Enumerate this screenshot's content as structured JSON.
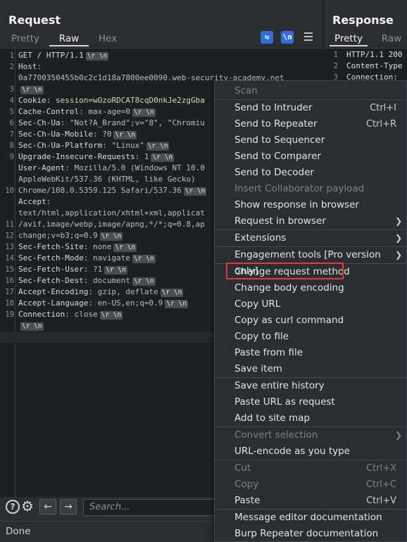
{
  "request": {
    "title": "Request",
    "tabs": [
      "Pretty",
      "Raw",
      "Hex"
    ],
    "active_tab": "Raw",
    "tool_icons": [
      "wrap-lines-icon",
      "newline-icon",
      "menu-icon"
    ],
    "line_numbers": [
      "1",
      "2",
      "",
      "3",
      "4",
      "5",
      "6",
      "7",
      "8",
      "9",
      "",
      "",
      "10",
      "",
      "",
      "11",
      "12",
      "13",
      "14",
      "15",
      "16",
      "17",
      "18",
      "19"
    ],
    "lines": [
      {
        "k": "GET / HTTP/1.1",
        "v": "",
        "crlf": true
      },
      {
        "k": "Host",
        "v": ":",
        "crlf": false
      },
      {
        "k": "",
        "v": "0a7700350455b0c2c1d18a7800ee0090.web-security-academy.net",
        "crlf": false
      },
      {
        "k": "",
        "v": "",
        "crlf": true
      },
      {
        "k": "Cookie",
        "v": ": session=wOzoRDCAT8cqD0nkJe2zgGba",
        "crlf": false
      },
      {
        "k": "Cache-Control",
        "v": ": max-age=0",
        "crlf": true
      },
      {
        "k": "Sec-Ch-Ua",
        "v": ": \"Not?A_Brand\";v=\"8\", \"Chromiu",
        "crlf": false
      },
      {
        "k": "Sec-Ch-Ua-Mobile",
        "v": ": ?0",
        "crlf": true
      },
      {
        "k": "Sec-Ch-Ua-Platform",
        "v": ": \"Linux\"",
        "crlf": true
      },
      {
        "k": "Upgrade-Insecure-Requests",
        "v": ": 1",
        "crlf": true
      },
      {
        "k": "User-Agent",
        "v": ": Mozilla/5.0 (Windows NT 10.0",
        "crlf": false
      },
      {
        "k": "",
        "v": "AppleWebKit/537.36 (KHTML, like Gecko)",
        "crlf": false
      },
      {
        "k": "",
        "v": "Chrome/108.0.5359.125 Safari/537.36",
        "crlf": true
      },
      {
        "k": "Accept",
        "v": ":",
        "crlf": false
      },
      {
        "k": "",
        "v": "text/html,application/xhtml+xml,applicat",
        "crlf": false
      },
      {
        "k": "",
        "v": "/avif,image/webp,image/apng,*/*;q=0.8,ap",
        "crlf": false
      },
      {
        "k": "",
        "v": "change;v=b3;q=0.9",
        "crlf": true
      },
      {
        "k": "Sec-Fetch-Site",
        "v": ": none",
        "crlf": true
      },
      {
        "k": "Sec-Fetch-Mode",
        "v": ": navigate",
        "crlf": true
      },
      {
        "k": "Sec-Fetch-User",
        "v": ": ?1",
        "crlf": true
      },
      {
        "k": "Sec-Fetch-Dest",
        "v": ": document",
        "crlf": true
      },
      {
        "k": "Accept-Encoding",
        "v": ": gzip, deflate",
        "crlf": true
      },
      {
        "k": "Accept-Language",
        "v": ": en-US,en;q=0.9",
        "crlf": true
      },
      {
        "k": "Connection",
        "v": ": close",
        "crlf": true
      },
      {
        "k": "",
        "v": "",
        "crlf": true
      },
      {
        "k": "",
        "v": "",
        "crlf": false
      }
    ],
    "crlf_label": "\\r \\n",
    "search_placeholder": "Search..."
  },
  "response": {
    "title": "Response",
    "tabs": [
      "Pretty",
      "Raw"
    ],
    "active_tab": "Pretty",
    "lines": [
      {
        "n": "1",
        "t": "HTTP/1.1 200"
      },
      {
        "n": "2",
        "t": "Content-Type"
      },
      {
        "n": "3",
        "t": "Connection:"
      }
    ]
  },
  "status": "Done",
  "context_menu": {
    "items": [
      {
        "label": "Scan",
        "shortcut": "",
        "disabled": true,
        "submenu": false
      },
      {
        "sep": true
      },
      {
        "label": "Send to Intruder",
        "shortcut": "Ctrl+I",
        "disabled": false,
        "submenu": false
      },
      {
        "label": "Send to Repeater",
        "shortcut": "Ctrl+R",
        "disabled": false,
        "submenu": false
      },
      {
        "label": "Send to Sequencer",
        "shortcut": "",
        "disabled": false,
        "submenu": false
      },
      {
        "label": "Send to Comparer",
        "shortcut": "",
        "disabled": false,
        "submenu": false
      },
      {
        "label": "Send to Decoder",
        "shortcut": "",
        "disabled": false,
        "submenu": false
      },
      {
        "label": "Insert Collaborator payload",
        "shortcut": "",
        "disabled": true,
        "submenu": false
      },
      {
        "label": "Show response in browser",
        "shortcut": "",
        "disabled": false,
        "submenu": false
      },
      {
        "label": "Request in browser",
        "shortcut": "",
        "disabled": false,
        "submenu": true
      },
      {
        "sep": true
      },
      {
        "label": "Extensions",
        "shortcut": "",
        "disabled": false,
        "submenu": true
      },
      {
        "sep": true
      },
      {
        "label": "Engagement tools [Pro version only]",
        "shortcut": "",
        "disabled": false,
        "submenu": true
      },
      {
        "sep": true
      },
      {
        "label": "Change request method",
        "shortcut": "",
        "disabled": false,
        "submenu": false,
        "highlight": true
      },
      {
        "label": "Change body encoding",
        "shortcut": "",
        "disabled": false,
        "submenu": false
      },
      {
        "label": "Copy URL",
        "shortcut": "",
        "disabled": false,
        "submenu": false
      },
      {
        "label": "Copy as curl command",
        "shortcut": "",
        "disabled": false,
        "submenu": false
      },
      {
        "label": "Copy to file",
        "shortcut": "",
        "disabled": false,
        "submenu": false
      },
      {
        "label": "Paste from file",
        "shortcut": "",
        "disabled": false,
        "submenu": false
      },
      {
        "label": "Save item",
        "shortcut": "",
        "disabled": false,
        "submenu": false
      },
      {
        "sep": true
      },
      {
        "label": "Save entire history",
        "shortcut": "",
        "disabled": false,
        "submenu": false
      },
      {
        "label": "Paste URL as request",
        "shortcut": "",
        "disabled": false,
        "submenu": false
      },
      {
        "label": "Add to site map",
        "shortcut": "",
        "disabled": false,
        "submenu": false
      },
      {
        "sep": true
      },
      {
        "label": "Convert selection",
        "shortcut": "",
        "disabled": true,
        "submenu": true
      },
      {
        "label": "URL-encode as you type",
        "shortcut": "",
        "disabled": false,
        "submenu": false
      },
      {
        "sep": true
      },
      {
        "label": "Cut",
        "shortcut": "Ctrl+X",
        "disabled": true,
        "submenu": false
      },
      {
        "label": "Copy",
        "shortcut": "Ctrl+C",
        "disabled": true,
        "submenu": false
      },
      {
        "label": "Paste",
        "shortcut": "Ctrl+V",
        "disabled": false,
        "submenu": false
      },
      {
        "sep": true
      },
      {
        "label": "Message editor documentation",
        "shortcut": "",
        "disabled": false,
        "submenu": false
      },
      {
        "label": "Burp Repeater documentation",
        "shortcut": "",
        "disabled": false,
        "submenu": false
      }
    ]
  }
}
